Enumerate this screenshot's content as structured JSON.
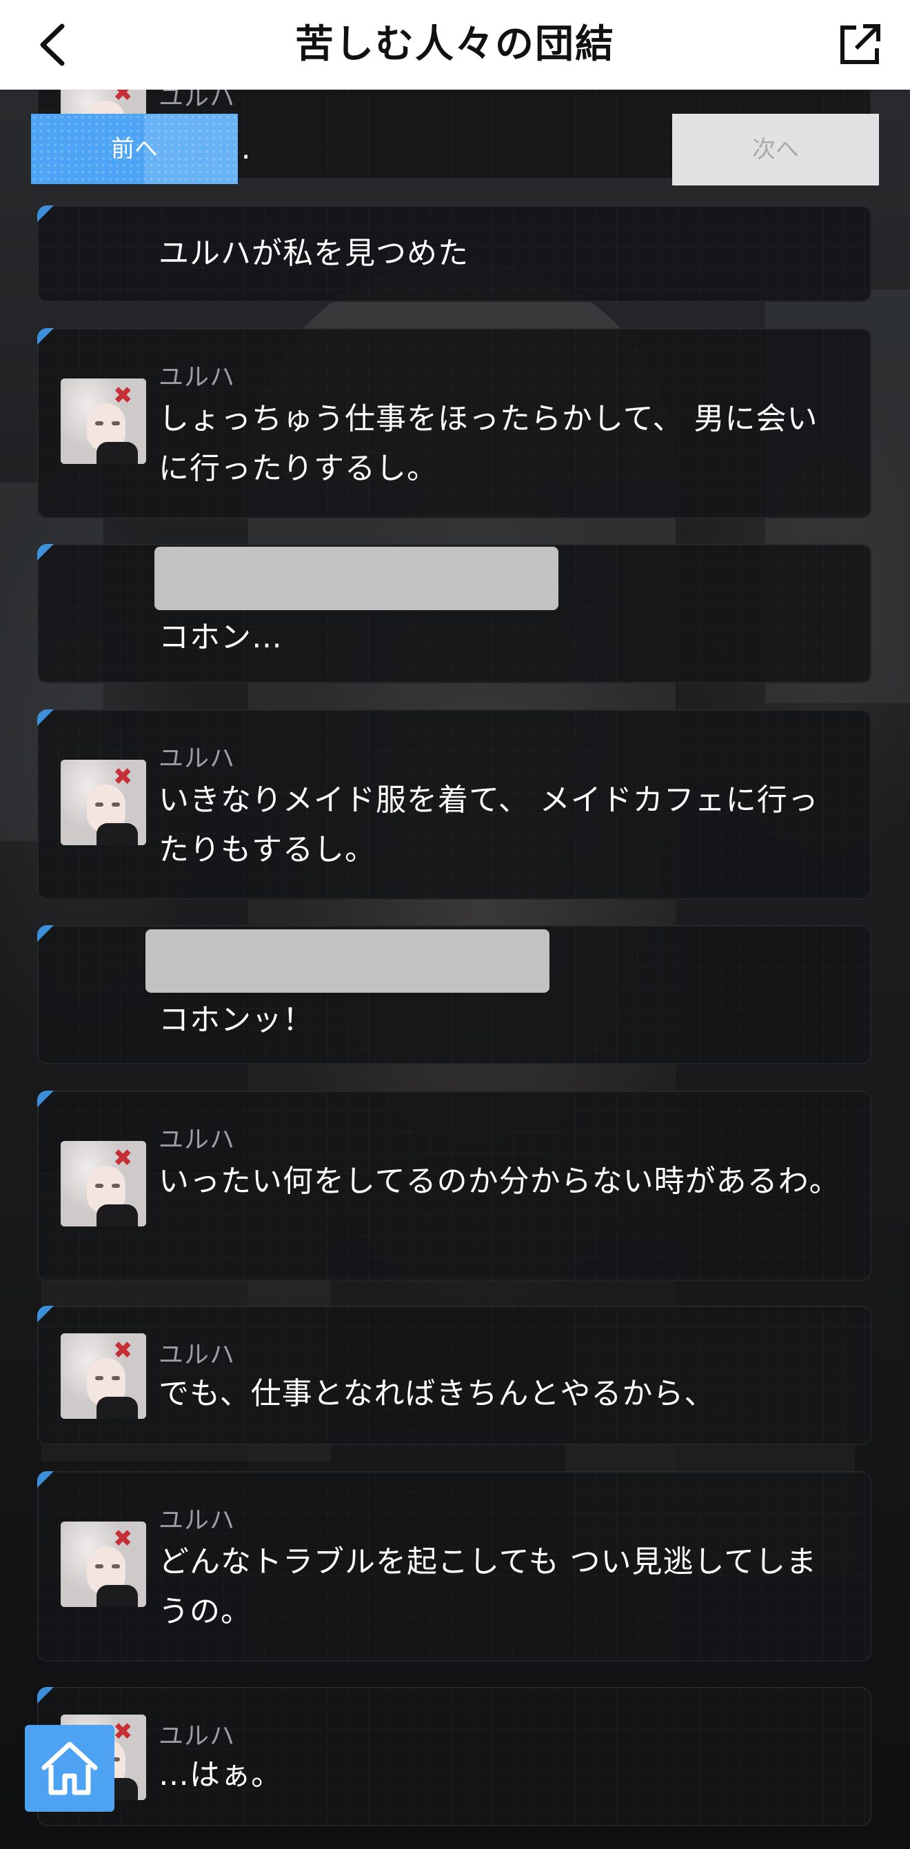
{
  "header": {
    "title": "苦しむ人々の団結",
    "back_icon": "chevron-left-icon",
    "share_icon": "external-link-icon"
  },
  "nav": {
    "prev_label": "前へ",
    "next_label": "次へ"
  },
  "home": {
    "icon": "home-icon"
  },
  "messages": [
    {
      "speaker": "ユルハ",
      "text": "…ど…"
    },
    {
      "speaker": "",
      "text": "ユルハが私を見つめた"
    },
    {
      "speaker": "ユルハ",
      "text": "しょっちゅう仕事をほったらかして、 男に会いに行ったりするし。"
    },
    {
      "speaker": "",
      "text": "コホン…"
    },
    {
      "speaker": "ユルハ",
      "text": "いきなりメイド服を着て、 メイドカフェに行ったりもするし。"
    },
    {
      "speaker": "",
      "text": "コホンッ！"
    },
    {
      "speaker": "ユルハ",
      "text": "いったい何をしてるのか分からない時があるわ。"
    },
    {
      "speaker": "ユルハ",
      "text": "でも、仕事となればきちんとやるから、"
    },
    {
      "speaker": "ユルハ",
      "text": "どんなトラブルを起こしても つい見逃してしまうの。"
    },
    {
      "speaker": "ユルハ",
      "text": "…はぁ。"
    }
  ],
  "colors": {
    "accent": "#4ea4f5",
    "card_bg": "#141517",
    "header_bg": "#ffffff"
  }
}
